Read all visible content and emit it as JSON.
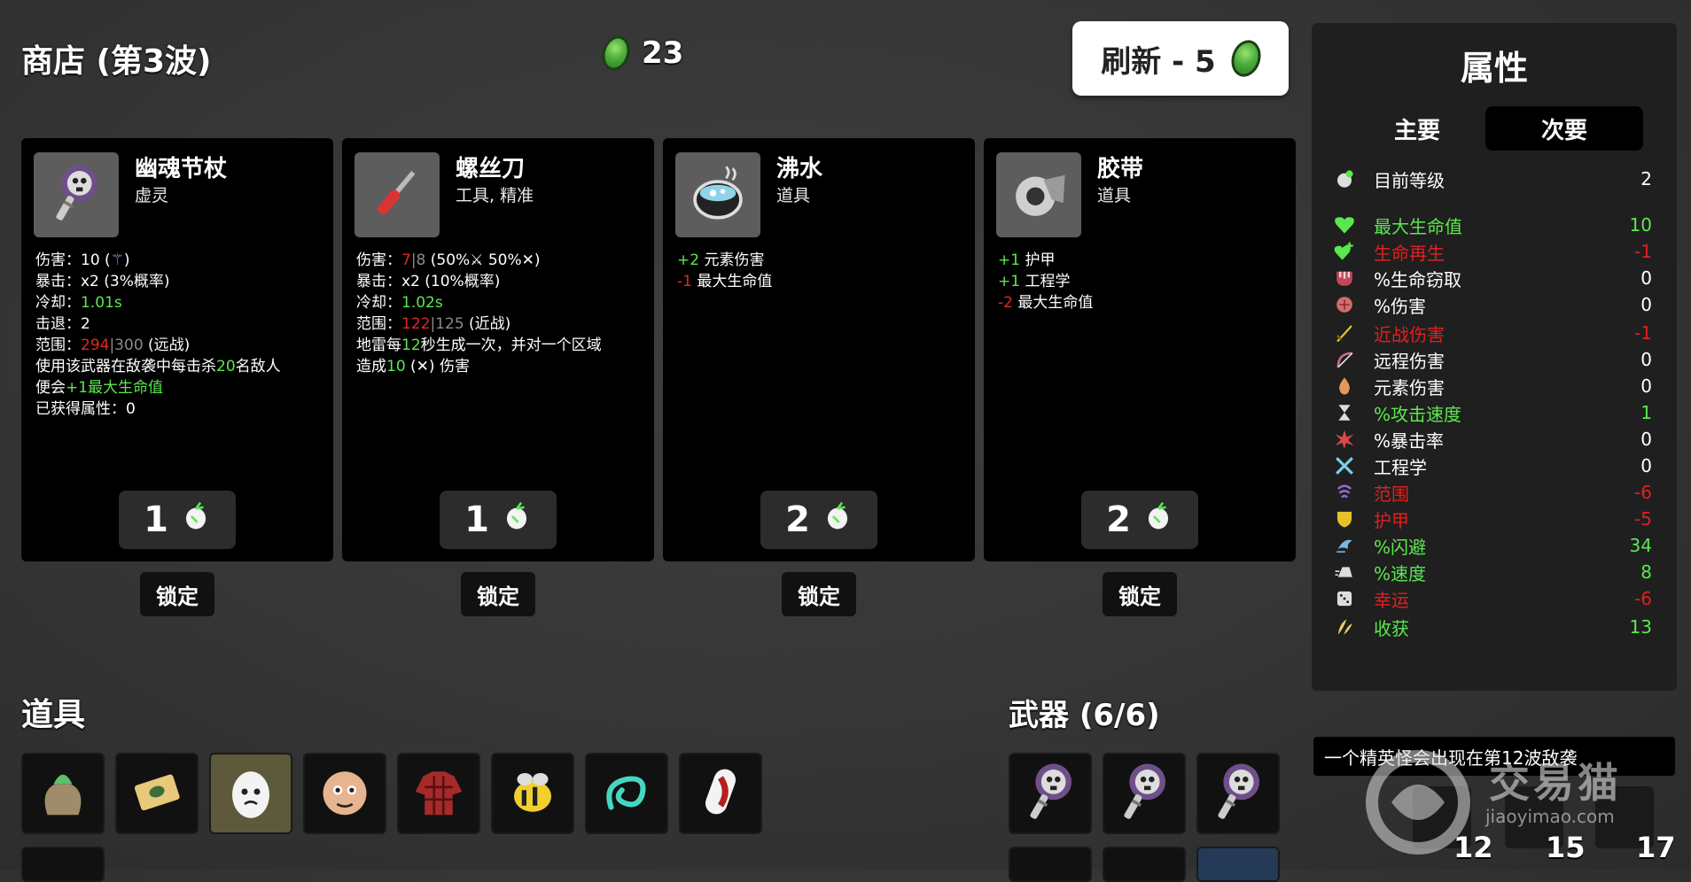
{
  "header": {
    "shop_title": "商店 (第3波)",
    "gold": "23",
    "refresh_label": "刷新 - 5"
  },
  "cards": [
    {
      "name": "幽魂节杖",
      "type": "虚灵",
      "icon": "ghost-scepter-icon",
      "lines": [
        [
          {
            "t": "伤害：10 ("
          },
          {
            "t": "⚚",
            "c": "purple"
          },
          {
            "t": ")"
          }
        ],
        [
          {
            "t": "暴击：x2 (3%概率)"
          }
        ],
        [
          {
            "t": "冷却："
          },
          {
            "t": "1.01s",
            "c": "green"
          }
        ],
        [
          {
            "t": "击退：2"
          }
        ],
        [
          {
            "t": "范围："
          },
          {
            "t": "294",
            "c": "red"
          },
          {
            "t": "|300",
            "c": "gray"
          },
          {
            "t": " (远战)"
          }
        ],
        [
          {
            "t": "使用该武器在敌袭中每击杀"
          },
          {
            "t": "20",
            "c": "green"
          },
          {
            "t": "名敌人"
          }
        ],
        [
          {
            "t": "便会"
          },
          {
            "t": "+1最大生命值",
            "c": "green"
          }
        ],
        [
          {
            "t": "已获得属性：0"
          }
        ]
      ],
      "price": "1",
      "lock_label": "锁定"
    },
    {
      "name": "螺丝刀",
      "type": "工具, 精准",
      "icon": "screwdriver-icon",
      "lines": [
        [
          {
            "t": "伤害："
          },
          {
            "t": "7",
            "c": "red"
          },
          {
            "t": "|8",
            "c": "gray"
          },
          {
            "t": " (50%⚔ 50%✕)"
          }
        ],
        [
          {
            "t": "暴击：x2 (10%概率)"
          }
        ],
        [
          {
            "t": "冷却："
          },
          {
            "t": "1.02s",
            "c": "green"
          }
        ],
        [
          {
            "t": "范围："
          },
          {
            "t": "122",
            "c": "red"
          },
          {
            "t": "|125",
            "c": "gray"
          },
          {
            "t": " (近战)"
          }
        ],
        [
          {
            "t": "地雷每"
          },
          {
            "t": "12",
            "c": "green"
          },
          {
            "t": "秒生成一次，并对一个区域"
          }
        ],
        [
          {
            "t": "造成"
          },
          {
            "t": "10",
            "c": "green"
          },
          {
            "t": " (✕) 伤害"
          }
        ]
      ],
      "price": "1",
      "lock_label": "锁定"
    },
    {
      "name": "沸水",
      "type": "道具",
      "icon": "boiling-water-icon",
      "lines": [
        [
          {
            "t": "+2",
            "c": "green"
          },
          {
            "t": " 元素伤害"
          }
        ],
        [
          {
            "t": "-1",
            "c": "red"
          },
          {
            "t": " 最大生命值"
          }
        ]
      ],
      "price": "2",
      "lock_label": "锁定"
    },
    {
      "name": "胶带",
      "type": "道具",
      "icon": "duct-tape-icon",
      "lines": [
        [
          {
            "t": "+1",
            "c": "green"
          },
          {
            "t": " 护甲"
          }
        ],
        [
          {
            "t": "+1",
            "c": "green"
          },
          {
            "t": " 工程学"
          }
        ],
        [
          {
            "t": "-2",
            "c": "red"
          },
          {
            "t": " 最大生命值"
          }
        ]
      ],
      "price": "2",
      "lock_label": "锁定"
    }
  ],
  "stats": {
    "title": "属性",
    "tab_main": "主要",
    "tab_secondary": "次要",
    "rows": [
      {
        "icon": "level-icon",
        "label": "目前等级",
        "value": "2",
        "color": "white"
      },
      {
        "icon": "heart-icon",
        "label": "最大生命值",
        "value": "10",
        "color": "green"
      },
      {
        "icon": "hp-regen-icon",
        "label": "生命再生",
        "value": "-1",
        "color": "red"
      },
      {
        "icon": "life-steal-icon",
        "label": "%生命窃取",
        "value": "0",
        "color": "white"
      },
      {
        "icon": "damage-icon",
        "label": "%伤害",
        "value": "0",
        "color": "white"
      },
      {
        "icon": "melee-damage-icon",
        "label": "近战伤害",
        "value": "-1",
        "color": "red"
      },
      {
        "icon": "ranged-damage-icon",
        "label": "远程伤害",
        "value": "0",
        "color": "white"
      },
      {
        "icon": "elemental-damage-icon",
        "label": "元素伤害",
        "value": "0",
        "color": "white"
      },
      {
        "icon": "attack-speed-icon",
        "label": "%攻击速度",
        "value": "1",
        "color": "green"
      },
      {
        "icon": "crit-chance-icon",
        "label": "%暴击率",
        "value": "0",
        "color": "white"
      },
      {
        "icon": "engineering-icon",
        "label": "工程学",
        "value": "0",
        "color": "white"
      },
      {
        "icon": "range-icon",
        "label": "范围",
        "value": "-6",
        "color": "red"
      },
      {
        "icon": "armor-icon",
        "label": "护甲",
        "value": "-5",
        "color": "red"
      },
      {
        "icon": "dodge-icon",
        "label": "%闪避",
        "value": "34",
        "color": "green"
      },
      {
        "icon": "speed-icon",
        "label": "%速度",
        "value": "8",
        "color": "green"
      },
      {
        "icon": "luck-icon",
        "label": "幸运",
        "value": "-6",
        "color": "red"
      },
      {
        "icon": "harvesting-icon",
        "label": "收获",
        "value": "13",
        "color": "green"
      }
    ]
  },
  "items_section": {
    "title": "道具",
    "items": [
      "sack-icon",
      "treasure-map-icon",
      "egg-face-icon",
      "face-portrait-icon",
      "plaid-shirt-icon",
      "bee-icon",
      "cyan-swirl-icon",
      "capsule-icon"
    ]
  },
  "weapons_section": {
    "title": "武器 (6/6)",
    "weapons": [
      "ghost-scepter-icon",
      "ghost-scepter-icon",
      "ghost-scepter-icon"
    ]
  },
  "wave_notice": "一个精英怪会出现在第12波敌袭",
  "wave_markers": [
    "12",
    "15",
    "17"
  ],
  "watermark": {
    "text": "交易猫",
    "url": "jiaoyimao.com"
  }
}
